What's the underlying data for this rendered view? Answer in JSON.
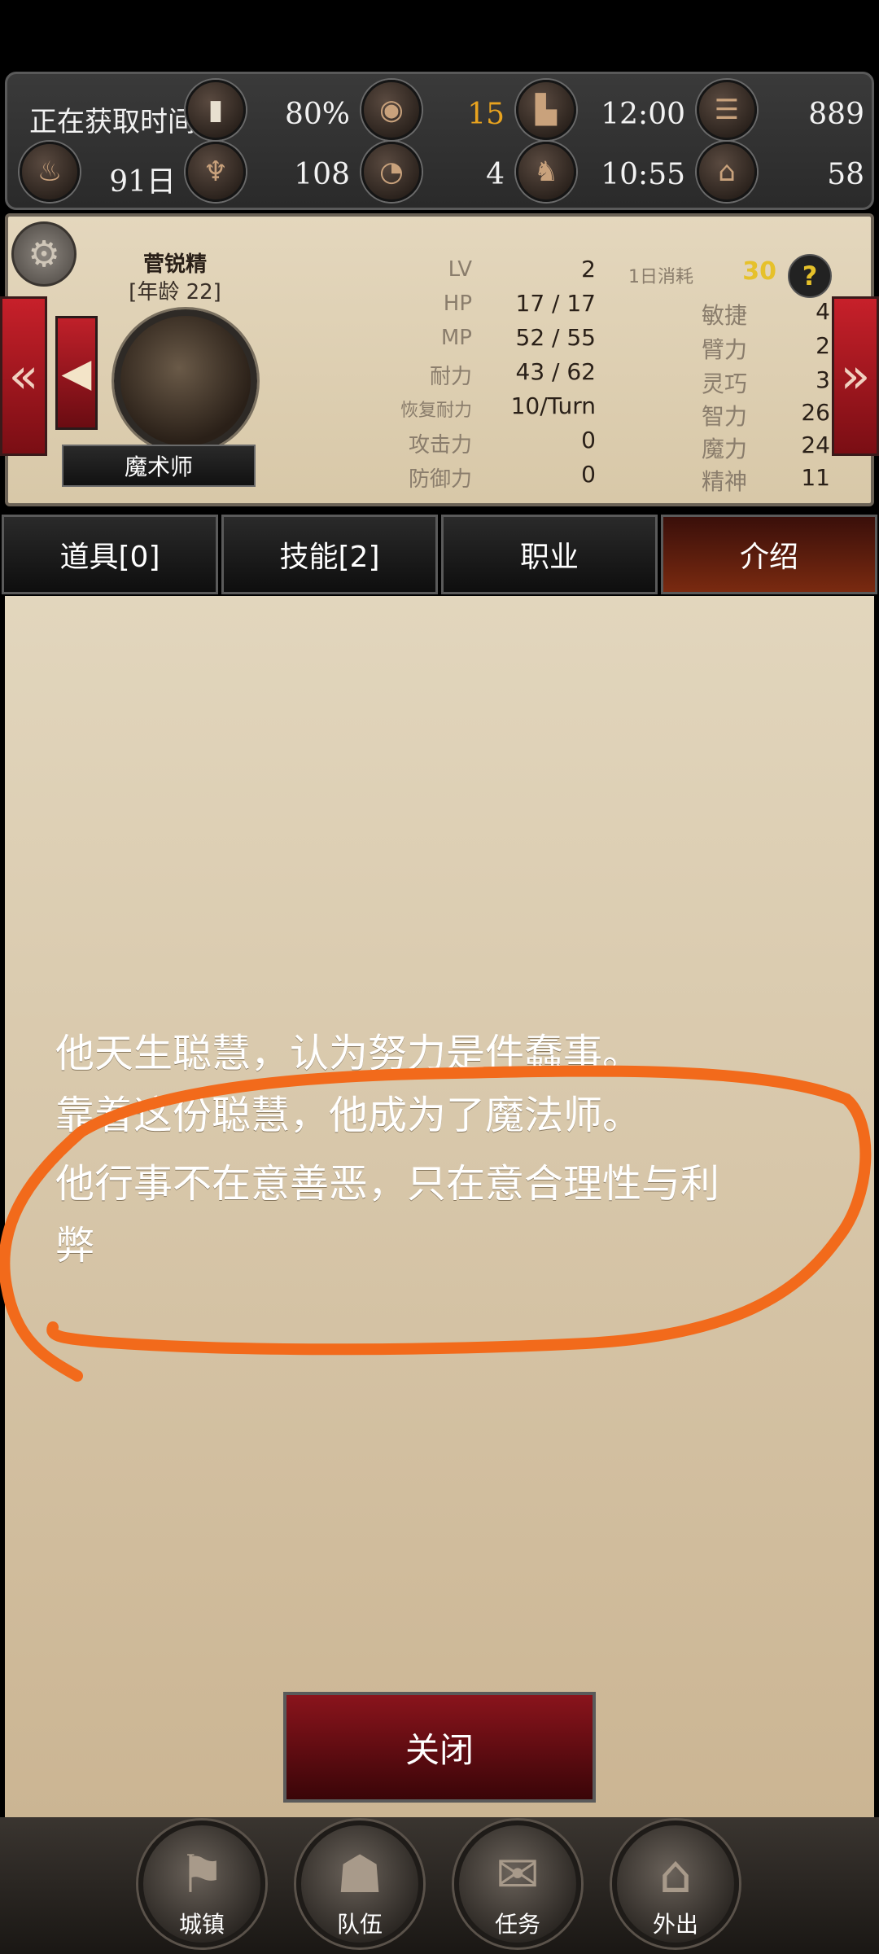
{
  "resources": {
    "row1": {
      "acquire_time_label": "正在获取时间",
      "battery_value": "80%",
      "food_value": "15",
      "boot_time": "12:00",
      "coins_value": "889"
    },
    "row2": {
      "days_value": "91日",
      "statue_value": "108",
      "meat_value": "4",
      "figure_time": "10:55",
      "hat_value": "58"
    },
    "food_color": "#e8a31f"
  },
  "character": {
    "name": "菅锐精",
    "age": "[年龄 22]",
    "class": "魔术师",
    "daily_cost_label": "1日消耗",
    "daily_cost_value": "30",
    "help_glyph": "?",
    "stats_left": [
      {
        "label": "LV",
        "value": "2"
      },
      {
        "label": "HP",
        "value": "17 / 17"
      },
      {
        "label": "MP",
        "value": "52 / 55"
      },
      {
        "label": "耐力",
        "value": "43 / 62"
      },
      {
        "label": "恢复耐力",
        "value": "10/Turn"
      },
      {
        "label": "攻击力",
        "value": "0"
      },
      {
        "label": "防御力",
        "value": "0"
      }
    ],
    "stats_right": [
      {
        "label": "敏捷",
        "value": "4"
      },
      {
        "label": "臂力",
        "value": "2"
      },
      {
        "label": "灵巧",
        "value": "3"
      },
      {
        "label": "智力",
        "value": "26"
      },
      {
        "label": "魔力",
        "value": "24"
      },
      {
        "label": "精神",
        "value": "11"
      }
    ]
  },
  "tabs": [
    {
      "label": "道具[0]"
    },
    {
      "label": "技能[2]"
    },
    {
      "label": "职业"
    },
    {
      "label": "介绍"
    }
  ],
  "description": [
    "他天生聪慧，认为努力是件蠢事。",
    "靠着这份聪慧，他成为了魔法师。",
    "他行事不在意善恶，只在意合理性与利",
    "弊"
  ],
  "close_label": "关闭",
  "bottom_nav": [
    {
      "label": "城镇"
    },
    {
      "label": "队伍"
    },
    {
      "label": "任务"
    },
    {
      "label": "外出"
    }
  ],
  "annotation_color": "#f26a1b"
}
